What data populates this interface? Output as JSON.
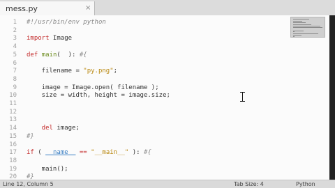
{
  "tab": {
    "title": "mess.py",
    "close_glyph": "×"
  },
  "lines": [
    {
      "n": "1",
      "segs": [
        {
          "t": "#!/usr/bin/env python",
          "c": "cm"
        }
      ]
    },
    {
      "n": "2",
      "segs": []
    },
    {
      "n": "3",
      "segs": [
        {
          "t": "import",
          "c": "kw"
        },
        {
          "t": " Image",
          "c": ""
        }
      ]
    },
    {
      "n": "4",
      "segs": []
    },
    {
      "n": "5",
      "segs": [
        {
          "t": "def",
          "c": "kw"
        },
        {
          "t": " ",
          "c": ""
        },
        {
          "t": "main",
          "c": "fn"
        },
        {
          "t": "(  ): ",
          "c": ""
        },
        {
          "t": "#{",
          "c": "cm"
        }
      ]
    },
    {
      "n": "6",
      "segs": []
    },
    {
      "n": "7",
      "segs": [
        {
          "t": "    filename = ",
          "c": ""
        },
        {
          "t": "\"py.png\"",
          "c": "str"
        },
        {
          "t": ";",
          "c": ""
        }
      ]
    },
    {
      "n": "8",
      "segs": []
    },
    {
      "n": "9",
      "segs": [
        {
          "t": "    image = Image.open( filename );",
          "c": ""
        }
      ]
    },
    {
      "n": "10",
      "segs": [
        {
          "t": "    size = width, height = image.size;",
          "c": ""
        }
      ]
    },
    {
      "n": "11",
      "segs": []
    },
    {
      "n": "12",
      "segs": []
    },
    {
      "n": "13",
      "segs": []
    },
    {
      "n": "14",
      "segs": [
        {
          "t": "    ",
          "c": ""
        },
        {
          "t": "del",
          "c": "kw"
        },
        {
          "t": " image;",
          "c": ""
        }
      ]
    },
    {
      "n": "15",
      "segs": [
        {
          "t": "#}",
          "c": "cm"
        }
      ]
    },
    {
      "n": "16",
      "segs": []
    },
    {
      "n": "17",
      "segs": [
        {
          "t": "if",
          "c": "kw"
        },
        {
          "t": " ( ",
          "c": ""
        },
        {
          "t": "__name__",
          "c": "nm"
        },
        {
          "t": " ",
          "c": ""
        },
        {
          "t": "==",
          "c": "kw"
        },
        {
          "t": " ",
          "c": ""
        },
        {
          "t": "\"__main__\"",
          "c": "str"
        },
        {
          "t": " ): ",
          "c": ""
        },
        {
          "t": "#{",
          "c": "cm"
        }
      ]
    },
    {
      "n": "18",
      "segs": []
    },
    {
      "n": "19",
      "segs": [
        {
          "t": "    main();",
          "c": ""
        }
      ]
    },
    {
      "n": "20",
      "segs": [
        {
          "t": "#}",
          "c": "cm"
        }
      ]
    }
  ],
  "status": {
    "position": "Line 12, Column 5",
    "tab_size": "Tab Size: 4",
    "language": "Python"
  }
}
